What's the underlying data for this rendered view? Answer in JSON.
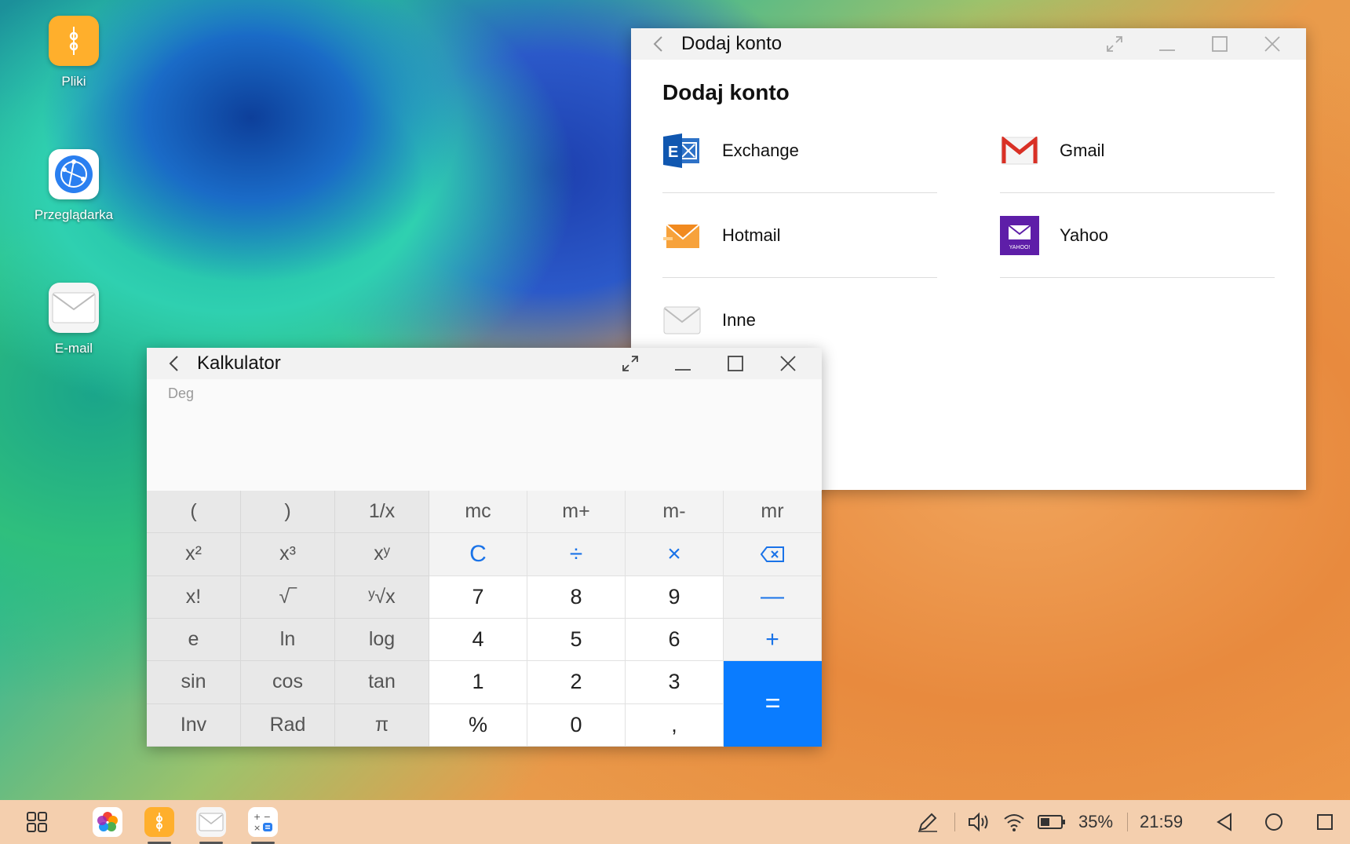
{
  "desktop": {
    "icons": [
      {
        "label": "Pliki",
        "icon": "folder-icon"
      },
      {
        "label": "Przeglądarka",
        "icon": "browser-icon"
      },
      {
        "label": "E-mail",
        "icon": "mail-icon"
      }
    ]
  },
  "email_window": {
    "title": "Dodaj konto",
    "heading": "Dodaj konto",
    "accounts": [
      {
        "name": "Exchange",
        "icon": "exchange-icon"
      },
      {
        "name": "Gmail",
        "icon": "gmail-icon"
      },
      {
        "name": "Hotmail",
        "icon": "hotmail-icon"
      },
      {
        "name": "Yahoo",
        "icon": "yahoo-icon"
      },
      {
        "name": "Inne",
        "icon": "other-mail-icon"
      }
    ],
    "yahoo_logo_text": "YAHOO!"
  },
  "calculator": {
    "title": "Kalkulator",
    "mode": "Deg",
    "keys": {
      "open_paren": "(",
      "close_paren": ")",
      "reciprocal": "1/x",
      "mc": "mc",
      "m_plus": "m+",
      "m_minus": "m-",
      "mr": "mr",
      "square": "x²",
      "cube": "x³",
      "power": "xʸ",
      "clear": "C",
      "divide": "÷",
      "multiply": "×",
      "factorial": "x!",
      "sqrt": "√‾",
      "yroot": "ʸ√x",
      "seven": "7",
      "eight": "8",
      "nine": "9",
      "minus": "—",
      "e": "e",
      "ln": "ln",
      "log": "log",
      "four": "4",
      "five": "5",
      "six": "6",
      "plus": "+",
      "sin": "sin",
      "cos": "cos",
      "tan": "tan",
      "one": "1",
      "two": "2",
      "three": "3",
      "equals": "=",
      "inv": "Inv",
      "rad": "Rad",
      "pi": "π",
      "percent": "%",
      "zero": "0",
      "comma": ","
    }
  },
  "taskbar": {
    "battery": "35%",
    "time": "21:59"
  },
  "colors": {
    "accent": "#0a7cff",
    "taskbar": "#f4cfae"
  }
}
